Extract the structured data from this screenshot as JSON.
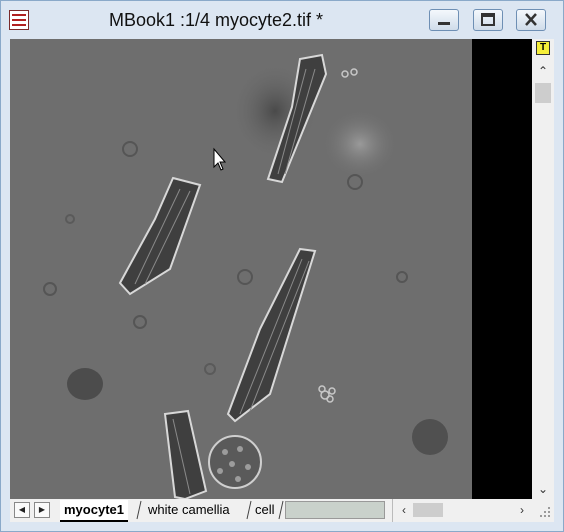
{
  "window": {
    "title": "MBook1 :1/4 myocyte2.tif *"
  },
  "toolbar": {
    "text_tool_label": "T"
  },
  "tabs": [
    {
      "label": "myocyte1",
      "active": true
    },
    {
      "label": "white camellia",
      "active": false
    },
    {
      "label": "cell",
      "active": false
    }
  ],
  "icons": {
    "app": "book-icon",
    "minimize": "minimize-icon",
    "maximize": "maximize-icon",
    "close": "close-icon",
    "scroll_up": "chevron-up-icon",
    "scroll_down": "chevron-down-icon",
    "scroll_left": "chevron-left-icon",
    "scroll_right": "chevron-right-icon",
    "tab_first": "tab-prev-icon",
    "tab_last": "tab-next-icon"
  },
  "colors": {
    "titlebar": "#dce6f2",
    "image_background": "#6f6f6f",
    "text_tool_button": "#f6ef3a"
  }
}
